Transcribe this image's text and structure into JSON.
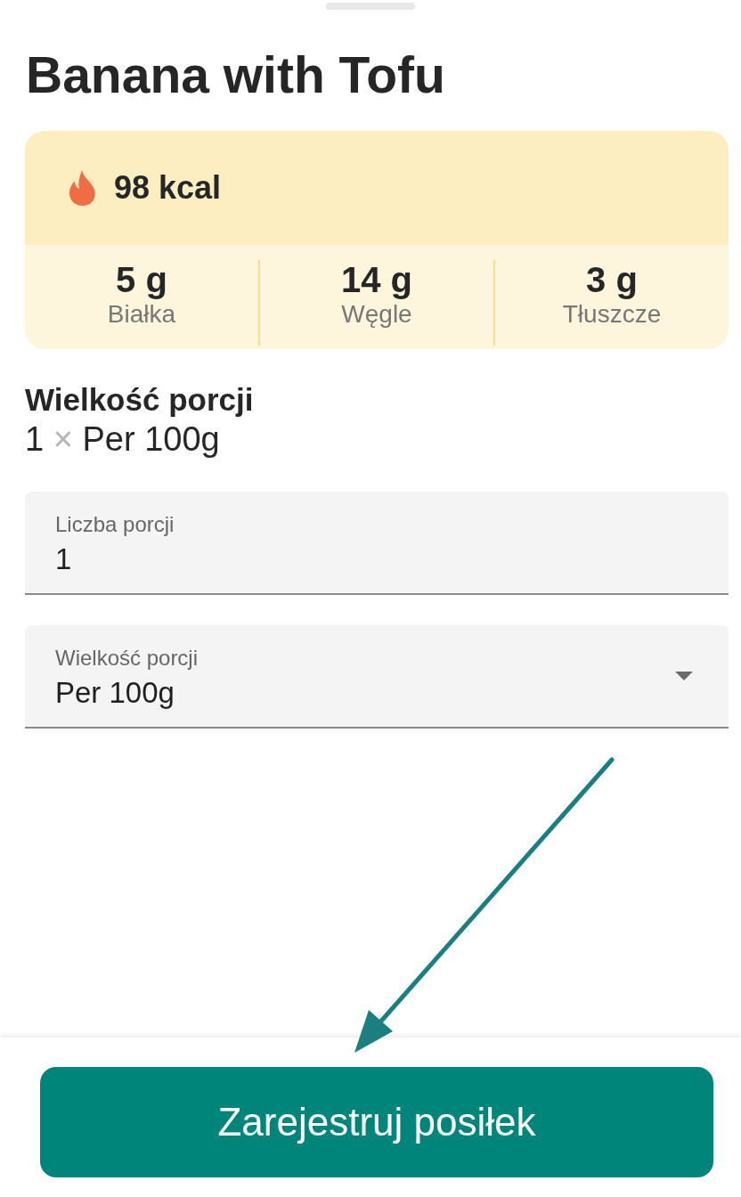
{
  "sheet": {
    "title": "Banana with Tofu"
  },
  "nutrition": {
    "calories": "98 kcal",
    "macros": [
      {
        "value": "5 g",
        "label": "Białka"
      },
      {
        "value": "14 g",
        "label": "Węgle"
      },
      {
        "value": "3 g",
        "label": "Tłuszcze"
      }
    ]
  },
  "serving": {
    "heading": "Wielkość porcji",
    "count": "1",
    "separator": "×",
    "unit": "Per 100g"
  },
  "fields": [
    {
      "kind": "text",
      "label": "Liczba porcji",
      "value": "1"
    },
    {
      "kind": "select",
      "label": "Wielkość porcji",
      "value": "Per 100g"
    }
  ],
  "action": {
    "label": "Zarejestruj posiłek"
  }
}
